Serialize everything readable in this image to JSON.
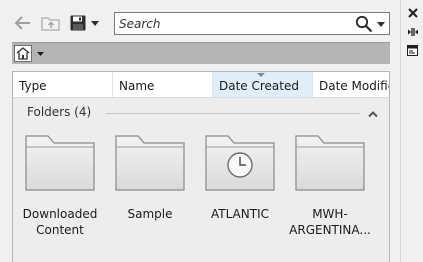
{
  "toolbar": {
    "back_icon": "back-arrow-icon",
    "up_folder_icon": "up-folder-icon",
    "save_icon": "floppy-disk-icon",
    "dropdown_icon": "chevron-down-icon"
  },
  "search": {
    "placeholder": "Search",
    "icon": "search-icon"
  },
  "palette": {
    "close_icon": "close-icon",
    "autohide_icon": "auto-hide-icon",
    "properties_icon": "properties-icon"
  },
  "navbar": {
    "home_icon": "home-icon"
  },
  "columns": [
    {
      "label": "Type",
      "sorted": false
    },
    {
      "label": "Name",
      "sorted": false
    },
    {
      "label": "Date Created",
      "sorted": true
    },
    {
      "label": "Date Modified",
      "sorted": false
    }
  ],
  "group": {
    "label": "Folders (4)",
    "collapse_icon": "chevron-up-icon"
  },
  "folders": [
    {
      "label": "Downloaded\nContent",
      "icon": "folder-icon"
    },
    {
      "label": "Sample",
      "icon": "folder-icon"
    },
    {
      "label": "ATLANTIC",
      "icon": "folder-clock-icon"
    },
    {
      "label": "MWH-\nARGENTINA...",
      "icon": "folder-icon"
    }
  ],
  "colors": {
    "window_bg": "#f0f0f0",
    "navbar_bg": "#b4b4b4",
    "sorted_column_bg": "#dfeef8",
    "folder_fill": "#e6e6e6",
    "folder_stroke": "#8a8a8a"
  }
}
